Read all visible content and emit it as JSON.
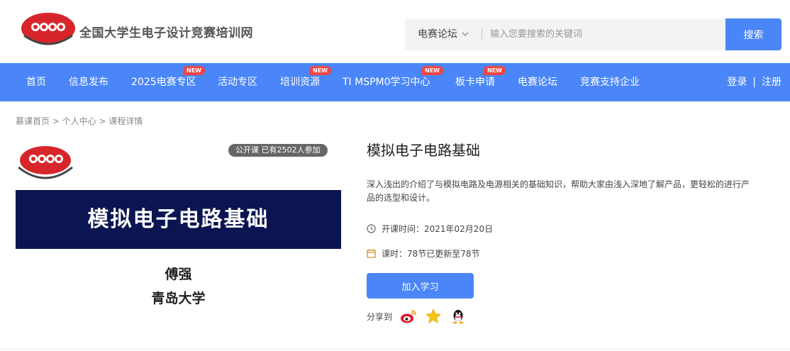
{
  "header": {
    "logo_text": "全国大学生电子设计竞赛培训网",
    "search": {
      "category": "电赛论坛",
      "placeholder": "输入您要搜索的关键词",
      "button_label": "搜索"
    }
  },
  "nav": {
    "items": [
      {
        "label": "首页",
        "badge": ""
      },
      {
        "label": "信息发布",
        "badge": ""
      },
      {
        "label": "2025电赛专区",
        "badge": "NEW"
      },
      {
        "label": "活动专区",
        "badge": ""
      },
      {
        "label": "培训资源",
        "badge": "NEW"
      },
      {
        "label": "TI MSPM0学习中心",
        "badge": "NEW"
      },
      {
        "label": "板卡申请",
        "badge": "NEW"
      },
      {
        "label": "电赛论坛",
        "badge": ""
      },
      {
        "label": "竞赛支持企业",
        "badge": ""
      }
    ],
    "login": "登录",
    "separator": "|",
    "register": "注册"
  },
  "breadcrumb": "慕课首页 > 个人中心 > 课程详情",
  "course": {
    "image": {
      "badge": "公开课   已有2502人参加",
      "banner_title": "模拟电子电路基础",
      "author": "傅强",
      "school": "青岛大学"
    },
    "title": "模拟电子电路基础",
    "description": "深入浅出的介绍了与模拟电路及电源相关的基础知识，帮助大家由浅入深地了解产品，更轻松的进行产品的选型和设计。",
    "start_time": "开课时间：2021年02月20日",
    "lessons": "课时：78节已更新至78节",
    "join_label": "加入学习",
    "share_label": "分享到"
  },
  "colors": {
    "primary": "#4a86f7",
    "badge_red": "#f04646",
    "banner_navy": "#0b1551",
    "logo_red": "#d7262b"
  }
}
